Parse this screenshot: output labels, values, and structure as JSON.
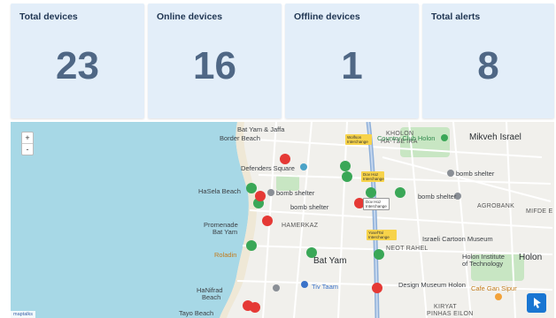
{
  "stats": [
    {
      "label": "Total devices",
      "value": "23"
    },
    {
      "label": "Online devices",
      "value": "16"
    },
    {
      "label": "Offline devices",
      "value": "1"
    },
    {
      "label": "Total alerts",
      "value": "8"
    }
  ],
  "map": {
    "zoom_in": "+",
    "zoom_out": "-",
    "attribution": "maptalks",
    "labels": {
      "bat_yam_jaffa": "Bat Yam & Jaffa",
      "border_beach": "Border Beach",
      "defenders_square": "Defenders Square",
      "hasela_beach": "HaSela Beach",
      "bomb_shelter_1": "bomb shelter",
      "bomb_shelter_2": "bomb shelter",
      "bomb_shelter_3": "bomb shelter",
      "bomb_shelter_4": "bomb shelter",
      "kholon": "KHOLON",
      "hatseira": "HA-TSE'IRA",
      "country_club": "Country Club Holon",
      "mikveh_israel": "Mikveh Israel",
      "agrobank": "AGROBANK",
      "mifde": "MIFDE E",
      "promenade1": "Promenade",
      "promenade2": "Bat Yam",
      "hamerkaz": "HAMERKAZ",
      "roladin": "Roladin",
      "bat_yam": "Bat Yam",
      "neot_rahel": "NEOT RAHEL",
      "cartoon_museum": "Israeli Cartoon Museum",
      "holon_institute1": "Holon Institute",
      "holon_institute2": "of Technology",
      "holon": "Holon",
      "hanifrad1": "HaNifrad",
      "hanifrad2": "Beach",
      "tiv_taam": "Tiv Taam",
      "design_museum": "Design Museum Holon",
      "cafe_gan": "Cafe Gan Sipur",
      "tayo_beach": "Tayo Beach",
      "kiryat": "KIRYAT",
      "pinhas_eilon": "PINHAS EILON",
      "wolfson": "Wolfson Interchange",
      "dov_hoz1": "Dov Hoz Interchange",
      "dov_hoz2": "Dov Hoz Interchange",
      "yosef_tal": "YosefTal Interchange"
    },
    "colors": {
      "water": "#a7d8e6",
      "park": "#c8e6c3",
      "marker_online": "#3aa757",
      "marker_alert": "#e53935",
      "tool_button": "#1976d2"
    }
  }
}
